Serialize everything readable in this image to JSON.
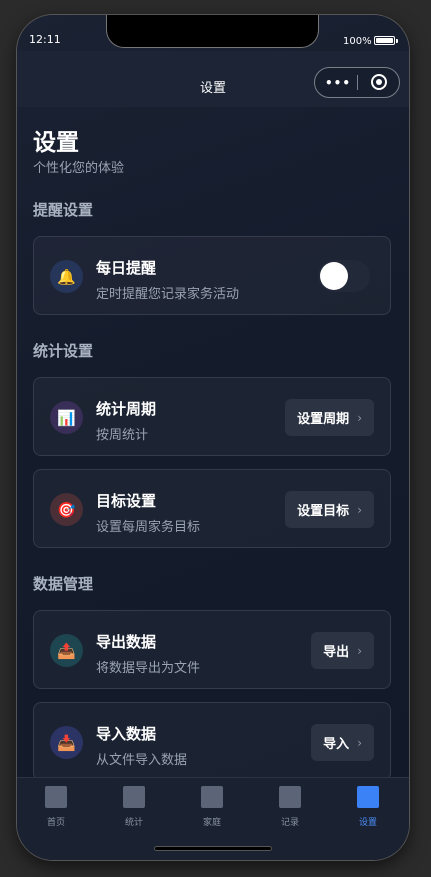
{
  "status": {
    "time": "12:11",
    "battery": "100%"
  },
  "navbar": {
    "title": "设置",
    "menu_icon": "more-dots-icon",
    "close_icon": "target-close-icon"
  },
  "page": {
    "title": "设置",
    "subtitle": "个性化您的体验"
  },
  "sections": {
    "reminder": {
      "title": "提醒设置"
    },
    "stats": {
      "title": "统计设置"
    },
    "data": {
      "title": "数据管理"
    }
  },
  "cards": {
    "daily_reminder": {
      "title": "每日提醒",
      "desc": "定时提醒您记录家务活动",
      "icon": "🔔",
      "icon_name": "bell-icon",
      "toggle_on": false
    },
    "stat_period": {
      "title": "统计周期",
      "desc": "按周统计",
      "icon": "📊",
      "icon_name": "chart-icon",
      "button": "设置周期",
      "chevron": "›"
    },
    "goal": {
      "title": "目标设置",
      "desc": "设置每周家务目标",
      "icon": "🎯",
      "icon_name": "target-icon",
      "button": "设置目标",
      "chevron": "›"
    },
    "export": {
      "title": "导出数据",
      "desc": "将数据导出为文件",
      "icon": "📤",
      "icon_name": "export-icon",
      "button": "导出",
      "chevron": "›"
    },
    "import": {
      "title": "导入数据",
      "desc": "从文件导入数据",
      "icon": "📥",
      "icon_name": "import-icon",
      "button": "导入",
      "chevron": "›"
    }
  },
  "tabbar": {
    "tabs": [
      {
        "label": "首页",
        "active": false
      },
      {
        "label": "统计",
        "active": false
      },
      {
        "label": "家庭",
        "active": false
      },
      {
        "label": "记录",
        "active": false
      },
      {
        "label": "设置",
        "active": true
      }
    ],
    "active_color": "#3b82f6"
  }
}
